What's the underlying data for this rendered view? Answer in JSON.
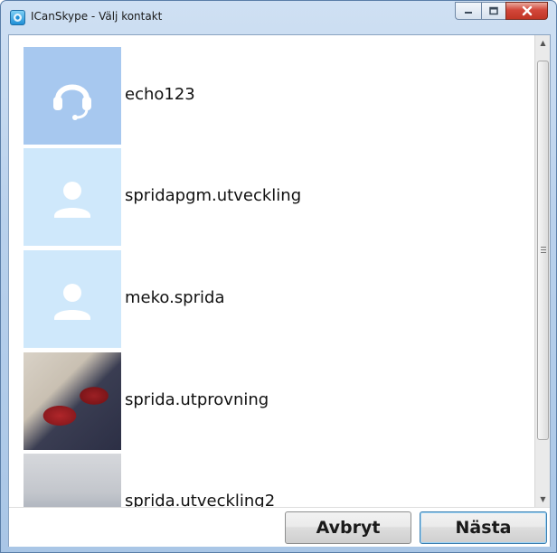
{
  "window": {
    "title": "ICanSkype - Välj kontakt"
  },
  "titlebar": {
    "buttons": [
      "minimize",
      "maximize",
      "close"
    ]
  },
  "contacts": [
    {
      "name": "echo123",
      "avatar": "headset-icon"
    },
    {
      "name": "spridapgm.utveckling",
      "avatar": "default-person-icon"
    },
    {
      "name": "meko.sprida",
      "avatar": "default-person-icon"
    },
    {
      "name": "sprida.utprovning",
      "avatar": "photo"
    },
    {
      "name": "sprida.utveckling2",
      "avatar": "photo"
    }
  ],
  "buttons": {
    "cancel": "Avbryt",
    "next": "Nästa"
  },
  "colors": {
    "echo_avatar_bg": "#a7c8ef",
    "default_avatar_bg": "#cfe8fb",
    "close_button": "#c13525"
  }
}
